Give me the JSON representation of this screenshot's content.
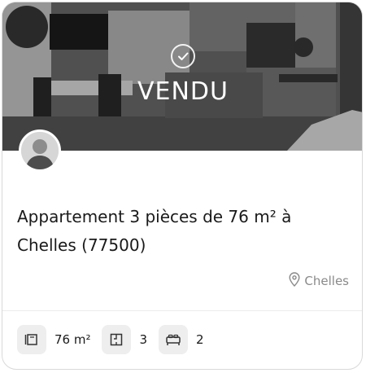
{
  "listing": {
    "status_label": "VENDU",
    "title": "Appartement 3 pièces de 76 m² à Chelles (77500)",
    "location": "Chelles",
    "features": [
      {
        "icon": "surface-icon",
        "value": "76 m²"
      },
      {
        "icon": "rooms-icon",
        "value": "3"
      },
      {
        "icon": "bed-icon",
        "value": "2"
      }
    ]
  }
}
